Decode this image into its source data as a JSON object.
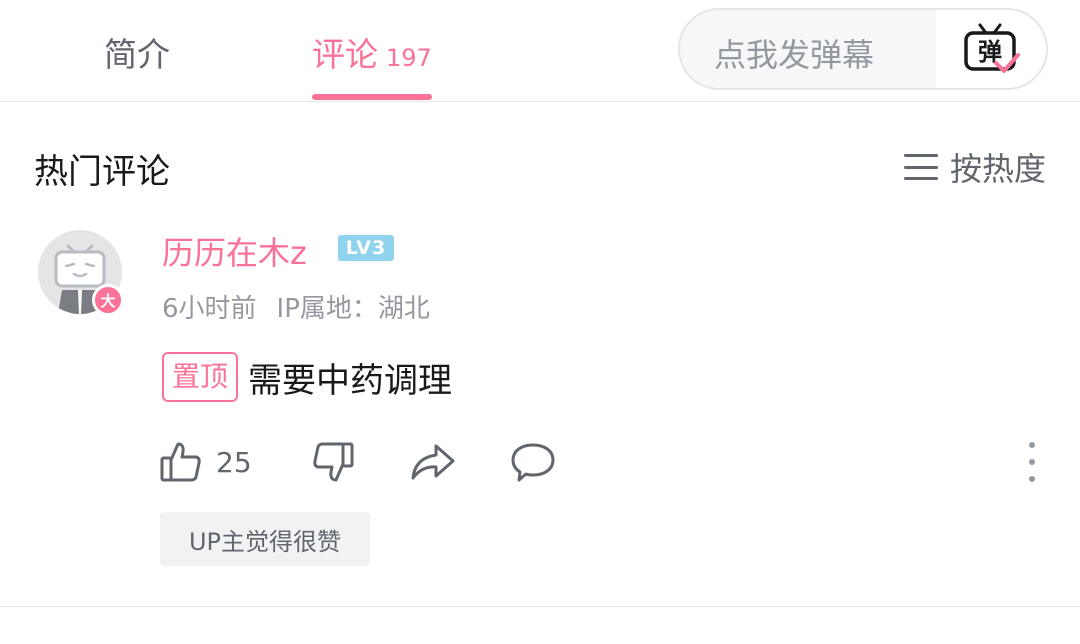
{
  "tabs": {
    "intro_label": "简介",
    "comments_label": "评论",
    "comments_count": "197"
  },
  "danmaku": {
    "placeholder": "点我发弹幕",
    "button_label": "弹"
  },
  "hot_comments": {
    "title": "热门评论",
    "sort_label": "按热度"
  },
  "comment": {
    "username": "历历在木z",
    "level": "LV3",
    "vip_badge": "大",
    "time": "6小时前",
    "ip_location": "IP属地：湖北",
    "pin_label": "置顶",
    "text": "需要中药调理",
    "like_count": "25",
    "up_liked_label": "UP主觉得很赞"
  },
  "colors": {
    "accent": "#fb7299",
    "level_badge": "#8fd3ef",
    "text_primary": "#18191c",
    "text_secondary": "#61666d",
    "text_muted": "#9499a0"
  },
  "icons": {
    "like": "thumbs-up-icon",
    "dislike": "thumbs-down-icon",
    "share": "share-icon",
    "reply": "reply-icon",
    "more": "more-vertical-icon",
    "sort": "menu-lines-icon",
    "danmaku": "tv-danmaku-icon"
  }
}
